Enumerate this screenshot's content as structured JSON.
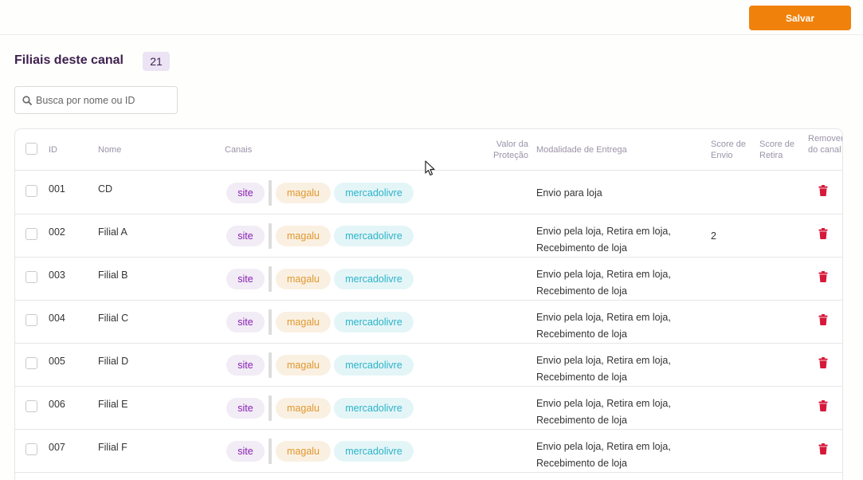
{
  "toolbar": {
    "save_label": "Salvar"
  },
  "page": {
    "title": "Filiais deste canal",
    "count": "21"
  },
  "search": {
    "placeholder": "Busca por nome ou ID"
  },
  "table": {
    "headers": {
      "id": "ID",
      "nome": "Nome",
      "canais": "Canais",
      "valor_protecao": "Valor da Proteção",
      "modalidade": "Modalidade de Entrega",
      "score_envio": "Score de Envio",
      "score_retira": "Score de Retira",
      "remover": "Remover do canal"
    },
    "rows": [
      {
        "id": "001",
        "nome": "CD",
        "canais": [
          "site",
          "magalu",
          "mercadolivre"
        ],
        "modalidade": "Envio para loja",
        "score_envio": "",
        "score_retira": ""
      },
      {
        "id": "002",
        "nome": "Filial A",
        "canais": [
          "site",
          "magalu",
          "mercadolivre"
        ],
        "modalidade": "Envio pela loja, Retira em loja, Recebimento de loja",
        "score_envio": "2",
        "score_retira": ""
      },
      {
        "id": "003",
        "nome": "Filial B",
        "canais": [
          "site",
          "magalu",
          "mercadolivre"
        ],
        "modalidade": "Envio pela loja, Retira em loja, Recebimento de loja",
        "score_envio": "",
        "score_retira": ""
      },
      {
        "id": "004",
        "nome": "Filial C",
        "canais": [
          "site",
          "magalu",
          "mercadolivre"
        ],
        "modalidade": "Envio pela loja, Retira em loja, Recebimento de loja",
        "score_envio": "",
        "score_retira": ""
      },
      {
        "id": "005",
        "nome": "Filial D",
        "canais": [
          "site",
          "magalu",
          "mercadolivre"
        ],
        "modalidade": "Envio pela loja, Retira em loja, Recebimento de loja",
        "score_envio": "",
        "score_retira": ""
      },
      {
        "id": "006",
        "nome": "Filial E",
        "canais": [
          "site",
          "magalu",
          "mercadolivre"
        ],
        "modalidade": "Envio pela loja, Retira em loja, Recebimento de loja",
        "score_envio": "",
        "score_retira": ""
      },
      {
        "id": "007",
        "nome": "Filial F",
        "canais": [
          "site",
          "magalu",
          "mercadolivre"
        ],
        "modalidade": "Envio pela loja, Retira em loja, Recebimento de loja",
        "score_envio": "",
        "score_retira": ""
      }
    ]
  },
  "icons": {
    "search": "search-icon",
    "delete": "trash-icon",
    "cursor": "mouse-pointer-icon"
  },
  "colors": {
    "accent": "#f0810a",
    "title": "#3d1f4e",
    "delete": "#d6183a",
    "site": "#8a1fb5",
    "magalu": "#e0982e",
    "mercadolivre": "#2bb3c9"
  }
}
